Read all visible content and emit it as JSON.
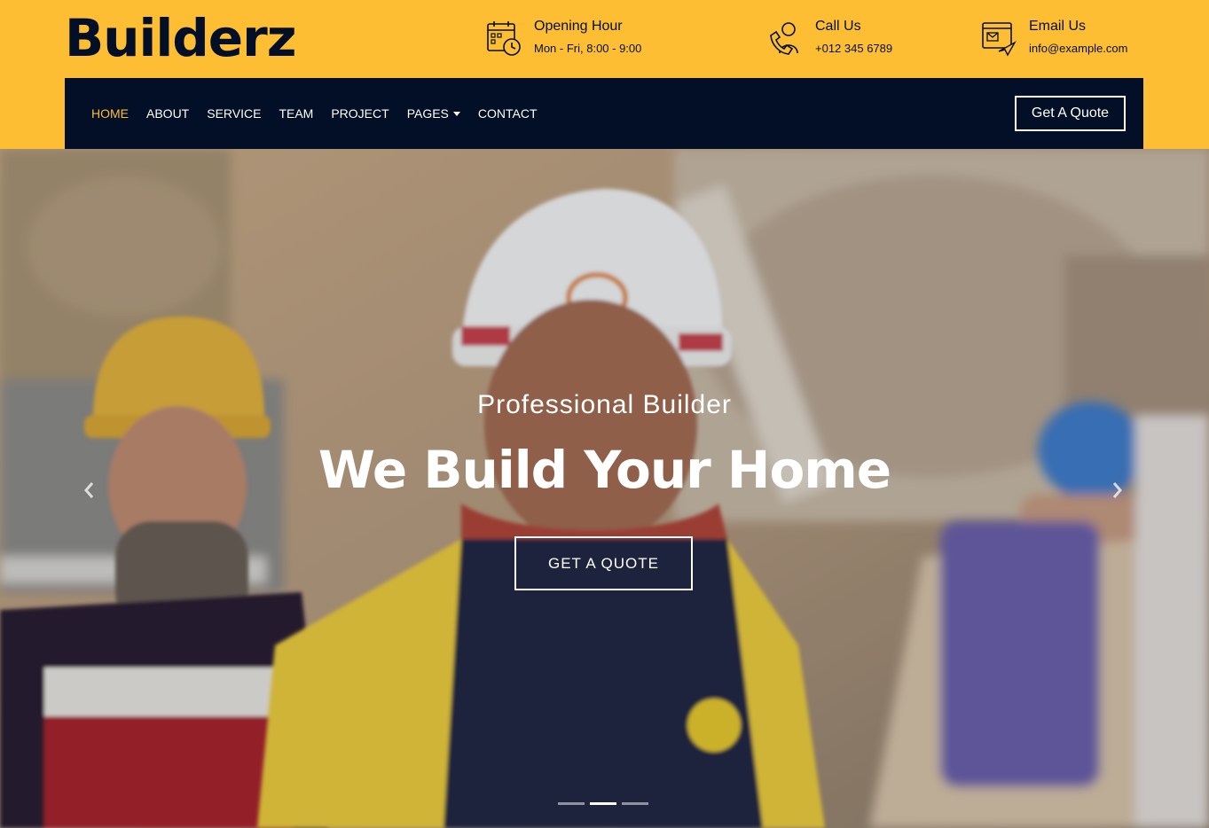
{
  "brand": {
    "logo": "Builderz"
  },
  "top_info": {
    "hours": {
      "title": "Opening Hour",
      "value": "Mon - Fri, 8:00 - 9:00",
      "icon": "calendar-clock-icon"
    },
    "call": {
      "title": "Call Us",
      "value": "+012 345 6789",
      "icon": "call-support-icon"
    },
    "email": {
      "title": "Email Us",
      "value": "info@example.com",
      "icon": "email-send-icon"
    }
  },
  "nav": {
    "items": [
      {
        "label": "HOME",
        "active": true
      },
      {
        "label": "ABOUT"
      },
      {
        "label": "SERVICE"
      },
      {
        "label": "TEAM"
      },
      {
        "label": "PROJECT"
      },
      {
        "label": "PAGES",
        "dropdown": true
      },
      {
        "label": "CONTACT"
      }
    ],
    "quote_label": "Get A Quote"
  },
  "hero": {
    "subtitle": "Professional Builder",
    "title": "We Build Your Home",
    "button_label": "GET A QUOTE",
    "slide_count": 3,
    "active_slide": 2
  },
  "colors": {
    "accent": "#fdbe33",
    "dark": "#030f27",
    "white": "#ffffff"
  }
}
